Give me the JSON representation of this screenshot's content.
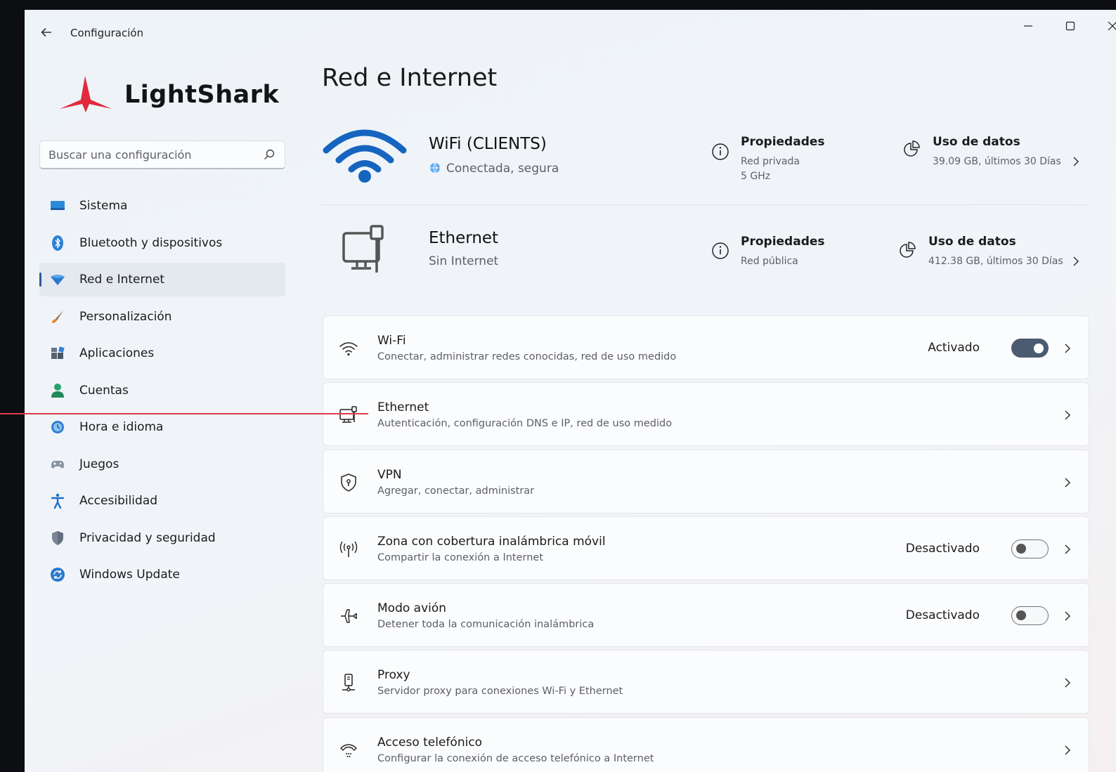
{
  "window": {
    "title": "Configuración"
  },
  "window_controls": {
    "minimize": "—",
    "maximize": "☐",
    "close": "✕"
  },
  "logo": {
    "text": "LightShark"
  },
  "search": {
    "placeholder": "Buscar una configuración"
  },
  "sidebar": {
    "items": [
      {
        "label": "Sistema",
        "icon": "monitor-icon"
      },
      {
        "label": "Bluetooth y dispositivos",
        "icon": "bluetooth-icon"
      },
      {
        "label": "Red e Internet",
        "icon": "network-diamond-icon",
        "active": true
      },
      {
        "label": "Personalización",
        "icon": "brush-icon"
      },
      {
        "label": "Aplicaciones",
        "icon": "apps-icon"
      },
      {
        "label": "Cuentas",
        "icon": "account-icon"
      },
      {
        "label": "Hora e idioma",
        "icon": "clock-globe-icon"
      },
      {
        "label": "Juegos",
        "icon": "gamepad-icon"
      },
      {
        "label": "Accesibilidad",
        "icon": "accessibility-icon"
      },
      {
        "label": "Privacidad y seguridad",
        "icon": "shield-icon"
      },
      {
        "label": "Windows Update",
        "icon": "update-icon"
      }
    ]
  },
  "main": {
    "title": "Red e Internet",
    "connections": [
      {
        "name": "WiFi (CLIENTS)",
        "status": "Conectada, segura",
        "properties": {
          "title": "Propiedades",
          "lines": [
            "Red privada",
            "5 GHz"
          ]
        },
        "usage": {
          "title": "Uso de datos",
          "detail": "39.09 GB, últimos 30 Días"
        }
      },
      {
        "name": "Ethernet",
        "status": "Sin Internet",
        "properties": {
          "title": "Propiedades",
          "lines": [
            "Red pública"
          ]
        },
        "usage": {
          "title": "Uso de datos",
          "detail": "412.38 GB, últimos 30 Días"
        }
      }
    ],
    "cards": [
      {
        "title": "Wi-Fi",
        "subtitle": "Conectar, administrar redes conocidas, red de uso medido",
        "state": "Activado",
        "toggle": true,
        "icon": "wifi-icon"
      },
      {
        "title": "Ethernet",
        "subtitle": "Autenticación, configuración DNS e IP, red de uso medido",
        "state": "",
        "icon": "ethernet-icon"
      },
      {
        "title": "VPN",
        "subtitle": "Agregar, conectar, administrar",
        "state": "",
        "icon": "vpn-shield-icon"
      },
      {
        "title": "Zona con cobertura inalámbrica móvil",
        "subtitle": "Compartir la conexión a Internet",
        "state": "Desactivado",
        "toggle": false,
        "icon": "hotspot-icon"
      },
      {
        "title": "Modo avión",
        "subtitle": "Detener toda la comunicación inalámbrica",
        "state": "Desactivado",
        "toggle": false,
        "icon": "airplane-icon"
      },
      {
        "title": "Proxy",
        "subtitle": "Servidor proxy para conexiones Wi-Fi y Ethernet",
        "state": "",
        "icon": "proxy-icon"
      },
      {
        "title": "Acceso telefónico",
        "subtitle": "Configurar la conexión de acceso telefónico a Internet",
        "state": "",
        "icon": "dialup-icon"
      }
    ]
  },
  "colors": {
    "accent": "#2d5b9a",
    "wifi_blue": "#1565c0",
    "logo_red": "#e0293c",
    "toggle_on": "#4a5b72"
  }
}
